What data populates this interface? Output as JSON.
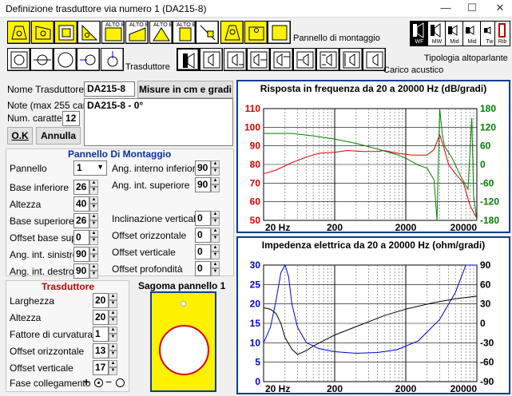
{
  "window": {
    "title": "Definizione trasduttore via numero 1 (DA215-8)",
    "minimize": "—",
    "maximize": "☐",
    "close": "✕"
  },
  "toolbar": {
    "icon_labels": [
      "ALTO B",
      "ALTO B",
      "ALTO B",
      "ALTO B"
    ],
    "pannello_label": "Pannello di montaggio",
    "trasduttore_label": "Trasduttore",
    "carico_label": "Carico acustico",
    "tipologia_label": "Tipologia altoparlante",
    "types": [
      "WF",
      "MW",
      "Mid",
      "Mid",
      "Tw",
      "Rib"
    ]
  },
  "form": {
    "nome_label": "Nome Trasduttore",
    "nome_value": "DA215-8",
    "misure_button": "Misure in cm e gradi",
    "note_label": "Note (max 255 car.)",
    "note_value": "DA215-8 - 0°",
    "num_label": "Num. caratteri",
    "num_value": "12",
    "ok_button": "O.K",
    "annulla_button": "Annulla"
  },
  "pannello": {
    "title": "Pannello Di Montaggio",
    "pannello_label": "Pannello",
    "pannello_value": "1",
    "rows": [
      {
        "label": "Base inferiore",
        "value": "26"
      },
      {
        "label": "Altezza",
        "value": "40"
      },
      {
        "label": "Base superiore",
        "value": "26"
      },
      {
        "label": "Offset base sup.",
        "value": "0"
      },
      {
        "label": "Ang. int. sinistro",
        "value": "90"
      },
      {
        "label": "Ang. int. destro",
        "value": "90"
      }
    ],
    "right_rows": [
      {
        "label": "Ang. interno inferiore",
        "value": "90"
      },
      {
        "label": "Ang. int. superiore",
        "value": "90"
      },
      {
        "label": "Inclinazione verticale",
        "value": "0"
      },
      {
        "label": "Offset orizzontale",
        "value": "0"
      },
      {
        "label": "Offset verticale",
        "value": "0"
      },
      {
        "label": "Offset profondità",
        "value": "0"
      }
    ]
  },
  "trasduttore": {
    "title": "Trasduttore",
    "rows": [
      {
        "label": "Larghezza",
        "value": "20"
      },
      {
        "label": "Altezza",
        "value": "20"
      },
      {
        "label": "Fattore di curvatura",
        "value": "1"
      },
      {
        "label": "Offset orizzontale",
        "value": "13"
      },
      {
        "label": "Offset verticale",
        "value": "17"
      }
    ],
    "fase_label": "Fase collegamento",
    "fase_plus": "+",
    "fase_minus": "−"
  },
  "sagoma": {
    "title": "Sagoma pannello 1"
  },
  "colors": {
    "accent": "#0a3f8f",
    "red_title": "#c00000",
    "blue_title": "#0a2fa8",
    "toolbar_yellow": "#fff200"
  },
  "chart_data": [
    {
      "type": "line",
      "title": "Risposta in frequenza da 20 a 20000 Hz (dB/gradi)",
      "x_scale": "log",
      "xlim": [
        20,
        20000
      ],
      "x_ticks": [
        "20 Hz",
        "200",
        "2000",
        "20000"
      ],
      "ylim_left": [
        50,
        110
      ],
      "y_ticks_left": [
        "110",
        "100",
        "90",
        "80",
        "70",
        "60",
        "50"
      ],
      "ylim_right": [
        -180,
        180
      ],
      "y_ticks_right": [
        "180",
        "120",
        "60",
        "0",
        "-60",
        "-120",
        "-180"
      ],
      "grid": true,
      "series": [
        {
          "color": "#e00000",
          "axis": "left",
          "x": [
            20,
            30,
            50,
            80,
            120,
            200,
            300,
            500,
            800,
            1000,
            1300,
            1600,
            2000,
            2500,
            3000,
            4000,
            5000,
            6000,
            7000,
            8000,
            10000,
            13000,
            16000,
            20000
          ],
          "values": [
            75,
            77,
            81,
            84,
            86,
            86.5,
            87.5,
            87,
            87,
            87.5,
            86.5,
            86,
            85.5,
            85,
            85,
            85,
            88,
            96,
            88,
            80,
            75,
            70,
            58,
            51
          ]
        },
        {
          "color": "#008000",
          "axis": "right",
          "x": [
            20,
            50,
            100,
            200,
            400,
            800,
            1500,
            2000,
            3000,
            4000,
            5000,
            5500,
            6000,
            6500,
            7000,
            9000,
            12000,
            15000,
            17000,
            18000,
            20000
          ],
          "values": [
            100,
            100,
            92,
            82,
            68,
            50,
            32,
            20,
            -2,
            -12,
            -50,
            -180,
            180,
            100,
            60,
            20,
            -40,
            -80,
            150,
            -100,
            -180
          ]
        }
      ]
    },
    {
      "type": "line",
      "title": "Impedenza elettrica da 20 a 20000 Hz (ohm/gradi)",
      "x_scale": "log",
      "xlim": [
        20,
        20000
      ],
      "x_ticks": [
        "20 Hz",
        "200",
        "2000",
        "20000"
      ],
      "ylim_left": [
        0,
        30
      ],
      "y_ticks_left": [
        "30",
        "25",
        "20",
        "15",
        "10",
        "5",
        "0"
      ],
      "ylim_right": [
        -90,
        90
      ],
      "y_ticks_right": [
        "90",
        "60",
        "30",
        "0",
        "-30",
        "-60",
        "-90"
      ],
      "grid": true,
      "series": [
        {
          "color": "#0000e0",
          "axis": "left",
          "x": [
            20,
            25,
            30,
            35,
            40,
            45,
            50,
            60,
            80,
            120,
            200,
            400,
            800,
            1500,
            3000,
            6000,
            10000,
            14000,
            20000
          ],
          "values": [
            10,
            14,
            21,
            28,
            30,
            27,
            20,
            14,
            10,
            8.5,
            7.7,
            7.3,
            7.5,
            8.2,
            10.5,
            16,
            23,
            30,
            30
          ]
        },
        {
          "color": "#000000",
          "axis": "right",
          "x": [
            20,
            25,
            30,
            35,
            40,
            50,
            60,
            80,
            100,
            200,
            400,
            1000,
            2000,
            5000,
            10000,
            20000
          ],
          "values": [
            24,
            22,
            15,
            0,
            -22,
            -40,
            -48,
            -42,
            -35,
            -18,
            -5,
            12,
            22,
            32,
            38,
            42
          ]
        }
      ]
    }
  ]
}
